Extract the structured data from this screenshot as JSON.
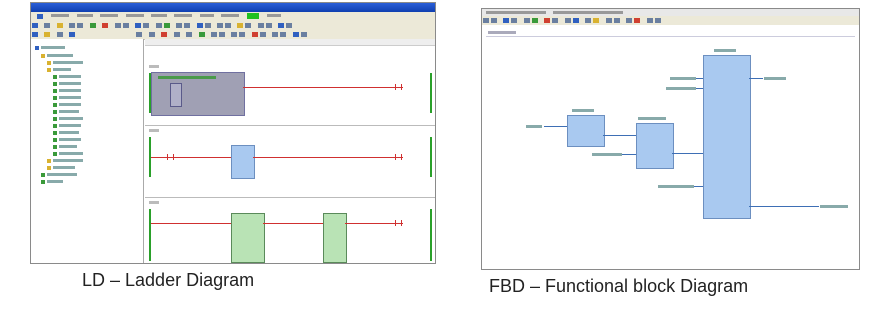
{
  "captions": {
    "ld": "LD – Ladder Diagram",
    "fbd": "FBD – Functional block Diagram"
  },
  "colors": {
    "titlebar": "#1f4fc4",
    "rail": "#2aa02a",
    "wire": "#d03030",
    "ld_block": "#b9e3b5",
    "ld_selected_block": "#a0a0b4",
    "fbd_block": "#a9c9f0"
  },
  "icons": [
    "folder-icon",
    "file-icon",
    "save-icon",
    "run-icon",
    "stop-icon",
    "zoom-icon",
    "contact-icon",
    "coil-icon",
    "block-icon"
  ]
}
